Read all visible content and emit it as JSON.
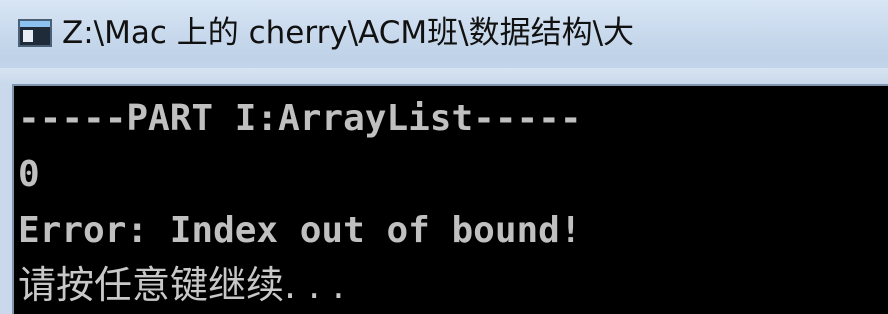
{
  "window": {
    "title": "Z:\\Mac 上的 cherry\\ACM班\\数据结构\\大",
    "icon": "console-window-icon"
  },
  "console": {
    "lines": [
      "-----PART I:ArrayList-----",
      "0",
      "Error: Index out of bound!",
      "请按任意键继续. . ."
    ],
    "text_color": "#c0c0c0",
    "background_color": "#000000"
  }
}
